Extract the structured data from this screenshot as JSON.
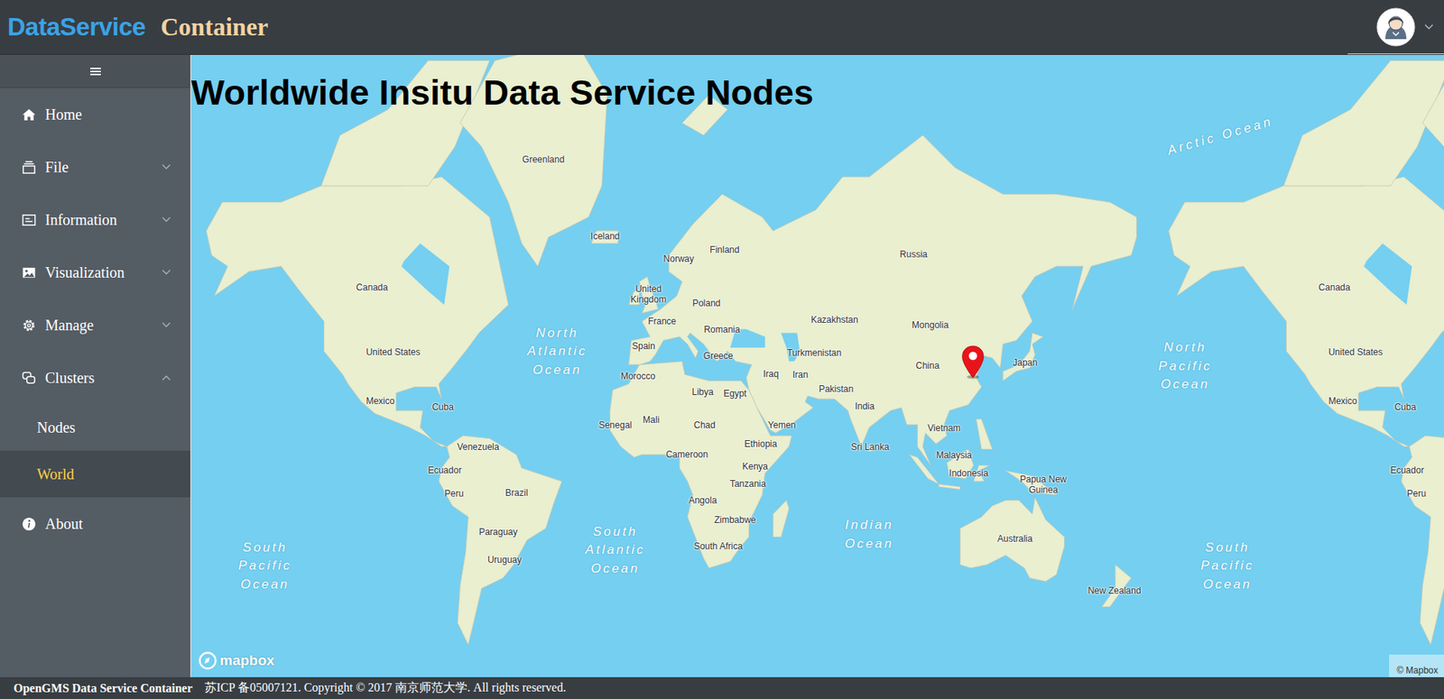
{
  "header": {
    "logo_primary": "DataService",
    "logo_secondary": "Container"
  },
  "sidebar": {
    "items": [
      {
        "label": "Home",
        "kind": "link",
        "expanded": false,
        "children": []
      },
      {
        "label": "File",
        "kind": "submenu",
        "expanded": false,
        "children": []
      },
      {
        "label": "Information",
        "kind": "submenu",
        "expanded": false,
        "children": []
      },
      {
        "label": "Visualization",
        "kind": "submenu",
        "expanded": false,
        "children": []
      },
      {
        "label": "Manage",
        "kind": "submenu",
        "expanded": false,
        "children": []
      },
      {
        "label": "Clusters",
        "kind": "submenu",
        "expanded": true,
        "children": [
          {
            "label": "Nodes",
            "selected": false
          },
          {
            "label": "World",
            "selected": true
          }
        ]
      },
      {
        "label": "About",
        "kind": "link",
        "expanded": false,
        "children": []
      }
    ]
  },
  "map": {
    "title": "Worldwide Insitu Data Service Nodes",
    "nodes": [
      {
        "lon": 118.78,
        "lat": 32.04
      }
    ],
    "labels": [
      {
        "text": "Greenland",
        "lon": -41.9,
        "lat": 74.7,
        "kind": "country"
      },
      {
        "text": "Iceland",
        "lon": -18.8,
        "lat": 65.1,
        "kind": "country"
      },
      {
        "text": "Norway",
        "lon": 8.7,
        "lat": 61.2,
        "kind": "country"
      },
      {
        "text": "Finland",
        "lon": 25.9,
        "lat": 62.8,
        "kind": "country"
      },
      {
        "text": "United Kingdom",
        "lon": -2.6,
        "lat": 54.2,
        "kind": "country"
      },
      {
        "text": "Poland",
        "lon": 19.1,
        "lat": 52.2,
        "kind": "country"
      },
      {
        "text": "France",
        "lon": 2.5,
        "lat": 47.8,
        "kind": "country"
      },
      {
        "text": "Romania",
        "lon": 24.9,
        "lat": 45.8,
        "kind": "country"
      },
      {
        "text": "Spain",
        "lon": -4.4,
        "lat": 41.2,
        "kind": "country"
      },
      {
        "text": "Greece",
        "lon": 23.5,
        "lat": 38.5,
        "kind": "country"
      },
      {
        "text": "Morocco",
        "lon": -6.5,
        "lat": 32.3,
        "kind": "country"
      },
      {
        "text": "Libya",
        "lon": 17.7,
        "lat": 27.2,
        "kind": "country"
      },
      {
        "text": "Egypt",
        "lon": 29.8,
        "lat": 26.6,
        "kind": "country"
      },
      {
        "text": "Iraq",
        "lon": 43.2,
        "lat": 32.9,
        "kind": "country"
      },
      {
        "text": "Iran",
        "lon": 54.2,
        "lat": 32.7,
        "kind": "country"
      },
      {
        "text": "Turkmenistan",
        "lon": 59.4,
        "lat": 39.3,
        "kind": "country"
      },
      {
        "text": "Kazakhstan",
        "lon": 67.0,
        "lat": 48.2,
        "kind": "country"
      },
      {
        "text": "Russia",
        "lon": 96.6,
        "lat": 62.0,
        "kind": "country"
      },
      {
        "text": "Mongolia",
        "lon": 102.8,
        "lat": 46.8,
        "kind": "country"
      },
      {
        "text": "China",
        "lon": 101.8,
        "lat": 35.5,
        "kind": "country"
      },
      {
        "text": "Japan",
        "lon": 138.3,
        "lat": 36.3,
        "kind": "country"
      },
      {
        "text": "Pakistan",
        "lon": 67.6,
        "lat": 28.1,
        "kind": "country"
      },
      {
        "text": "India",
        "lon": 78.3,
        "lat": 22.2,
        "kind": "country"
      },
      {
        "text": "Yemen",
        "lon": 47.3,
        "lat": 15.7,
        "kind": "country"
      },
      {
        "text": "Vietnam",
        "lon": 108.0,
        "lat": 14.4,
        "kind": "country"
      },
      {
        "text": "Sri Lanka",
        "lon": 80.3,
        "lat": 7.6,
        "kind": "country"
      },
      {
        "text": "Malaysia",
        "lon": 111.7,
        "lat": 4.6,
        "kind": "country"
      },
      {
        "text": "Indonesia",
        "lon": 117.2,
        "lat": -2.3,
        "kind": "country"
      },
      {
        "text": "Papua New Guinea",
        "lon": 145.1,
        "lat": -6.5,
        "kind": "country"
      },
      {
        "text": "Australia",
        "lon": 134.5,
        "lat": -25.9,
        "kind": "country"
      },
      {
        "text": "New Zealand",
        "lon": 171.7,
        "lat": -41.8,
        "kind": "country"
      },
      {
        "text": "Senegal",
        "lon": -15.0,
        "lat": 15.7,
        "kind": "country"
      },
      {
        "text": "Mali",
        "lon": -1.6,
        "lat": 17.4,
        "kind": "country"
      },
      {
        "text": "Chad",
        "lon": 18.4,
        "lat": 15.7,
        "kind": "country"
      },
      {
        "text": "Cameroon",
        "lon": 11.8,
        "lat": 4.9,
        "kind": "country"
      },
      {
        "text": "Ethiopia",
        "lon": 39.4,
        "lat": 8.7,
        "kind": "country"
      },
      {
        "text": "Kenya",
        "lon": 37.3,
        "lat": 0.4,
        "kind": "country"
      },
      {
        "text": "Tanzania",
        "lon": 34.6,
        "lat": -6.1,
        "kind": "country"
      },
      {
        "text": "Angola",
        "lon": 17.7,
        "lat": -12.2,
        "kind": "country"
      },
      {
        "text": "Zimbabwe",
        "lon": 29.8,
        "lat": -19.2,
        "kind": "country"
      },
      {
        "text": "South Africa",
        "lon": 23.5,
        "lat": -28.3,
        "kind": "country"
      },
      {
        "text": "Canada",
        "lon": -106.0,
        "lat": 55.6,
        "kind": "country"
      },
      {
        "text": "United States",
        "lon": -98.1,
        "lat": 39.6,
        "kind": "country"
      },
      {
        "text": "Mexico",
        "lon": -102.9,
        "lat": 24.1,
        "kind": "country"
      },
      {
        "text": "Cuba",
        "lon": -79.5,
        "lat": 21.9,
        "kind": "country"
      },
      {
        "text": "Venezuela",
        "lon": -66.3,
        "lat": 7.6,
        "kind": "country"
      },
      {
        "text": "Ecuador",
        "lon": -78.8,
        "lat": -1.0,
        "kind": "country"
      },
      {
        "text": "Peru",
        "lon": -75.3,
        "lat": -9.9,
        "kind": "country"
      },
      {
        "text": "Brazil",
        "lon": -51.9,
        "lat": -9.6,
        "kind": "country"
      },
      {
        "text": "Paraguay",
        "lon": -58.8,
        "lat": -23.4,
        "kind": "country"
      },
      {
        "text": "Uruguay",
        "lon": -56.4,
        "lat": -32.8,
        "kind": "country"
      },
      {
        "text": "North Atlantic Ocean",
        "lon": -36.7,
        "lat": 39.8,
        "kind": "ocean"
      },
      {
        "text": "South Atlantic Ocean",
        "lon": -15.0,
        "lat": -29.5,
        "kind": "ocean"
      },
      {
        "text": "Indian Ocean",
        "lon": 80.0,
        "lat": -24.3,
        "kind": "ocean"
      },
      {
        "text": "North Pacific Ocean",
        "lon": -161.8,
        "lat": 35.5,
        "kind": "ocean"
      },
      {
        "text": "South Pacific Ocean",
        "lon": -146.0,
        "lat": -34.5,
        "kind": "ocean"
      },
      {
        "text": "Arctic Ocean",
        "lon": -148.6,
        "lat": 76.9,
        "kind": "polar"
      }
    ],
    "logo": "mapbox",
    "attribution": "© Mapbox"
  },
  "footer": {
    "name": "OpenGMS Data Service Container",
    "notice": "苏ICP 备05007121. Copyright © 2017 南京师范大学. All rights reserved."
  }
}
